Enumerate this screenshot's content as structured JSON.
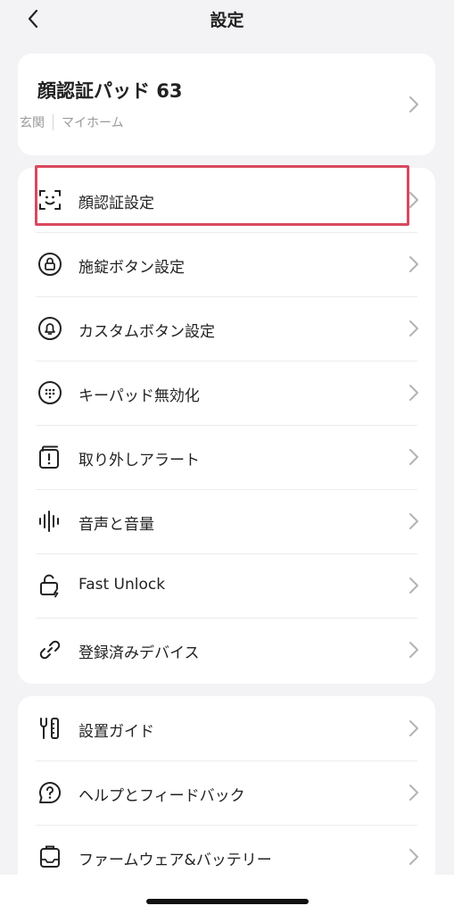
{
  "header": {
    "title": "設定",
    "back_icon": "chevron-left-icon"
  },
  "device": {
    "name": "顔認証パッド 63",
    "location": "玄関",
    "home": "マイホーム"
  },
  "settings_group": [
    {
      "label": "顔認証設定",
      "icon": "face-scan-icon"
    },
    {
      "label": "施錠ボタン設定",
      "icon": "lock-circle-icon"
    },
    {
      "label": "カスタムボタン設定",
      "icon": "bell-circle-icon"
    },
    {
      "label": "キーパッド無効化",
      "icon": "keypad-icon"
    },
    {
      "label": "取り外しアラート",
      "icon": "alert-device-icon"
    },
    {
      "label": "音声と音量",
      "icon": "sound-wave-icon"
    },
    {
      "label": "Fast Unlock",
      "icon": "fast-unlock-icon"
    },
    {
      "label": "登録済みデバイス",
      "icon": "link-icon"
    }
  ],
  "support_group": [
    {
      "label": "設置ガイド",
      "icon": "tools-icon"
    },
    {
      "label": "ヘルプとフィードバック",
      "icon": "help-icon"
    },
    {
      "label": "ファームウェア&バッテリー",
      "icon": "firmware-icon"
    }
  ],
  "colors": {
    "background": "#f3f3f5",
    "card": "#ffffff",
    "highlight": "#d9485e",
    "chevron": "#b3b3b3"
  }
}
